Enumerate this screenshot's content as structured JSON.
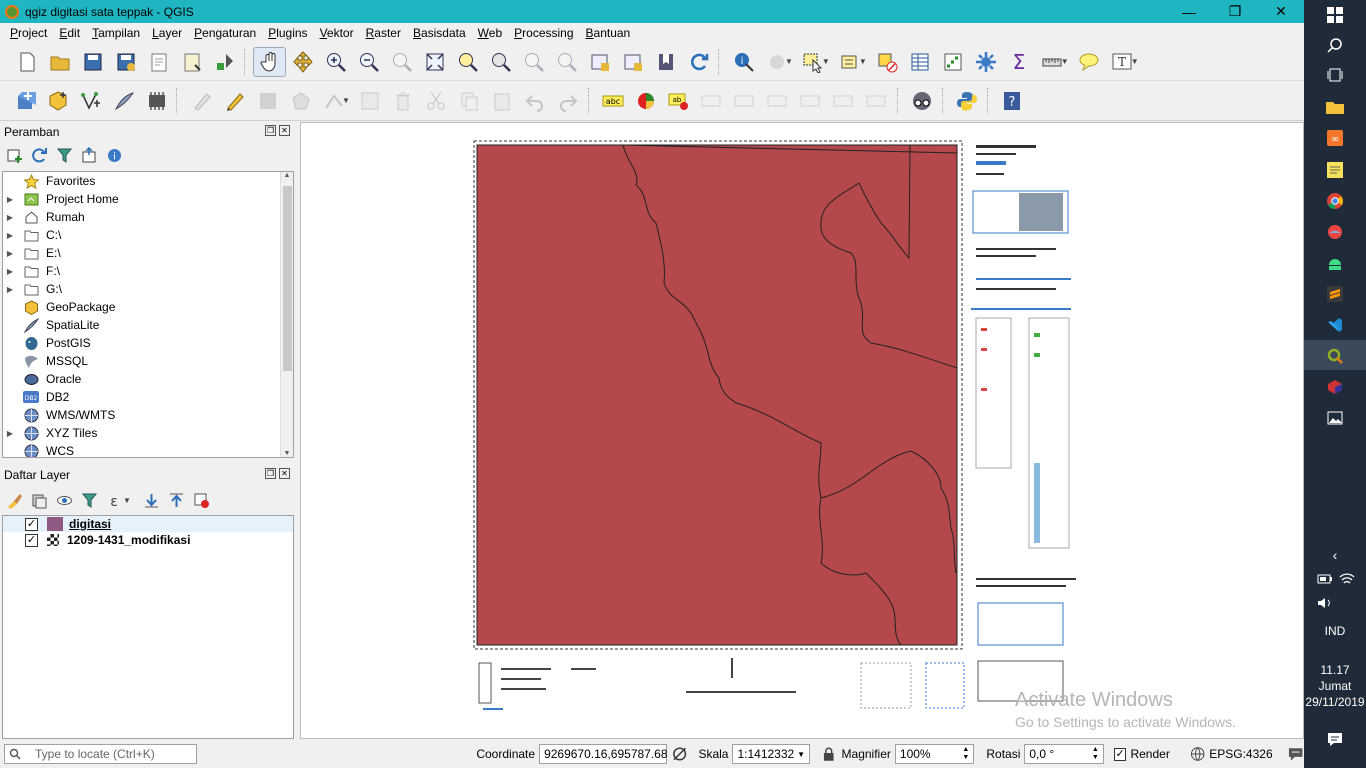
{
  "window": {
    "title": "qgiz digitasi sata teppak - QGIS"
  },
  "menu": [
    {
      "label": "Project",
      "u": "P",
      "rest": "roject"
    },
    {
      "label": "Edit",
      "u": "E",
      "rest": "dit"
    },
    {
      "label": "Tampilan",
      "u": "T",
      "rest": "ampilan"
    },
    {
      "label": "Layer",
      "u": "L",
      "rest": "ayer"
    },
    {
      "label": "Pengaturan",
      "u": "P",
      "rest": "engaturan"
    },
    {
      "label": "Plugins",
      "u": "P",
      "rest": "lugins"
    },
    {
      "label": "Vektor",
      "u": "V",
      "rest": "ektor"
    },
    {
      "label": "Raster",
      "u": "R",
      "rest": "aster"
    },
    {
      "label": "Basisdata",
      "u": "B",
      "rest": "asisdata"
    },
    {
      "label": "Web",
      "u": "W",
      "rest": "eb"
    },
    {
      "label": "Processing",
      "u": "P",
      "rest": "rocessing"
    },
    {
      "label": "Bantuan",
      "u": "B",
      "rest": "antuan"
    }
  ],
  "browser": {
    "title": "Peramban",
    "items": [
      {
        "label": "Favorites",
        "icon": "star-icon",
        "arrow": ""
      },
      {
        "label": "Project Home",
        "icon": "project-home-icon",
        "arrow": "▶"
      },
      {
        "label": "Rumah",
        "icon": "home-icon",
        "arrow": "▶"
      },
      {
        "label": "C:\\",
        "icon": "drive-icon",
        "arrow": "▶"
      },
      {
        "label": "E:\\",
        "icon": "drive-icon",
        "arrow": "▶"
      },
      {
        "label": "F:\\",
        "icon": "drive-icon",
        "arrow": "▶"
      },
      {
        "label": "G:\\",
        "icon": "drive-icon",
        "arrow": "▶"
      },
      {
        "label": "GeoPackage",
        "icon": "geopackage-icon",
        "arrow": ""
      },
      {
        "label": "SpatiaLite",
        "icon": "spatialite-icon",
        "arrow": ""
      },
      {
        "label": "PostGIS",
        "icon": "postgis-icon",
        "arrow": ""
      },
      {
        "label": "MSSQL",
        "icon": "mssql-icon",
        "arrow": ""
      },
      {
        "label": "Oracle",
        "icon": "oracle-icon",
        "arrow": ""
      },
      {
        "label": "DB2",
        "icon": "db2-icon",
        "arrow": ""
      },
      {
        "label": "WMS/WMTS",
        "icon": "wms-icon",
        "arrow": ""
      },
      {
        "label": "XYZ Tiles",
        "icon": "xyz-icon",
        "arrow": "▶"
      },
      {
        "label": "WCS",
        "icon": "wcs-icon",
        "arrow": ""
      }
    ]
  },
  "layers": {
    "title": "Daftar Layer",
    "items": [
      {
        "label": "digitasi",
        "checked": "✓",
        "color": "#8e5a84"
      },
      {
        "label": "1209-1431_modifikasi",
        "checked": "✓",
        "color": "raster"
      }
    ]
  },
  "map": {
    "polygon_color": "#b5484d",
    "watermark_line1": "Activate Windows",
    "watermark_line2": "Go to Settings to activate Windows."
  },
  "status": {
    "locate_placeholder": "Type to locate (Ctrl+K)",
    "coordinate_label": "Coordinate",
    "coordinate_value": "9269670.16,695787.68",
    "scale_label": "Skala",
    "scale_value": "1:1412332",
    "magnifier_label": "Magnifier",
    "magnifier_value": "100%",
    "rotation_label": "Rotasi",
    "rotation_value": "0,0 °",
    "render_label": "Render",
    "render_checked": "✓",
    "crs": "EPSG:4326"
  },
  "taskbar": {
    "lang": "IND",
    "time": "11.17",
    "day": "Jumat",
    "date": "29/11/2019"
  }
}
